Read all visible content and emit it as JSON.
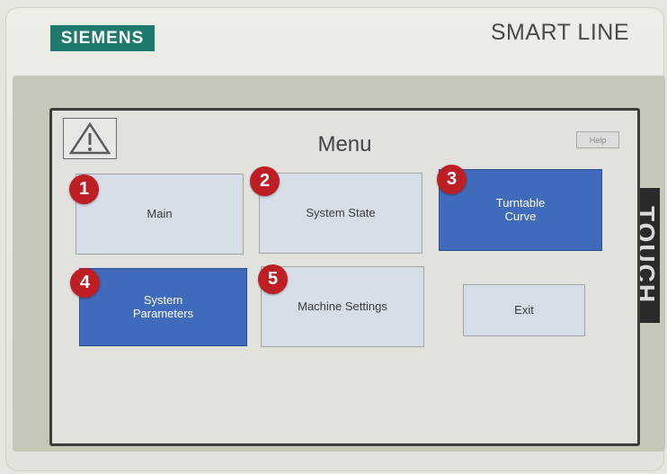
{
  "device": {
    "brand": "SIEMENS",
    "series": "SMART LINE",
    "side_label": "TOUCH"
  },
  "screen": {
    "title": "Menu",
    "help_label": "Help",
    "buttons": [
      {
        "label": "Main",
        "badge": "1"
      },
      {
        "label": "System State",
        "badge": "2"
      },
      {
        "label": "Turntable\nCurve",
        "badge": "3"
      },
      {
        "label": "System\nParameters",
        "badge": "4"
      },
      {
        "label": "Machine Settings",
        "badge": "5"
      },
      {
        "label": "Exit"
      }
    ]
  },
  "colors": {
    "brand": "#1f7a6e",
    "button_dark": "#3f6bba",
    "button_light": "#d6dde7",
    "badge": "#bd1f24"
  },
  "icons": [
    "warning-icon"
  ]
}
